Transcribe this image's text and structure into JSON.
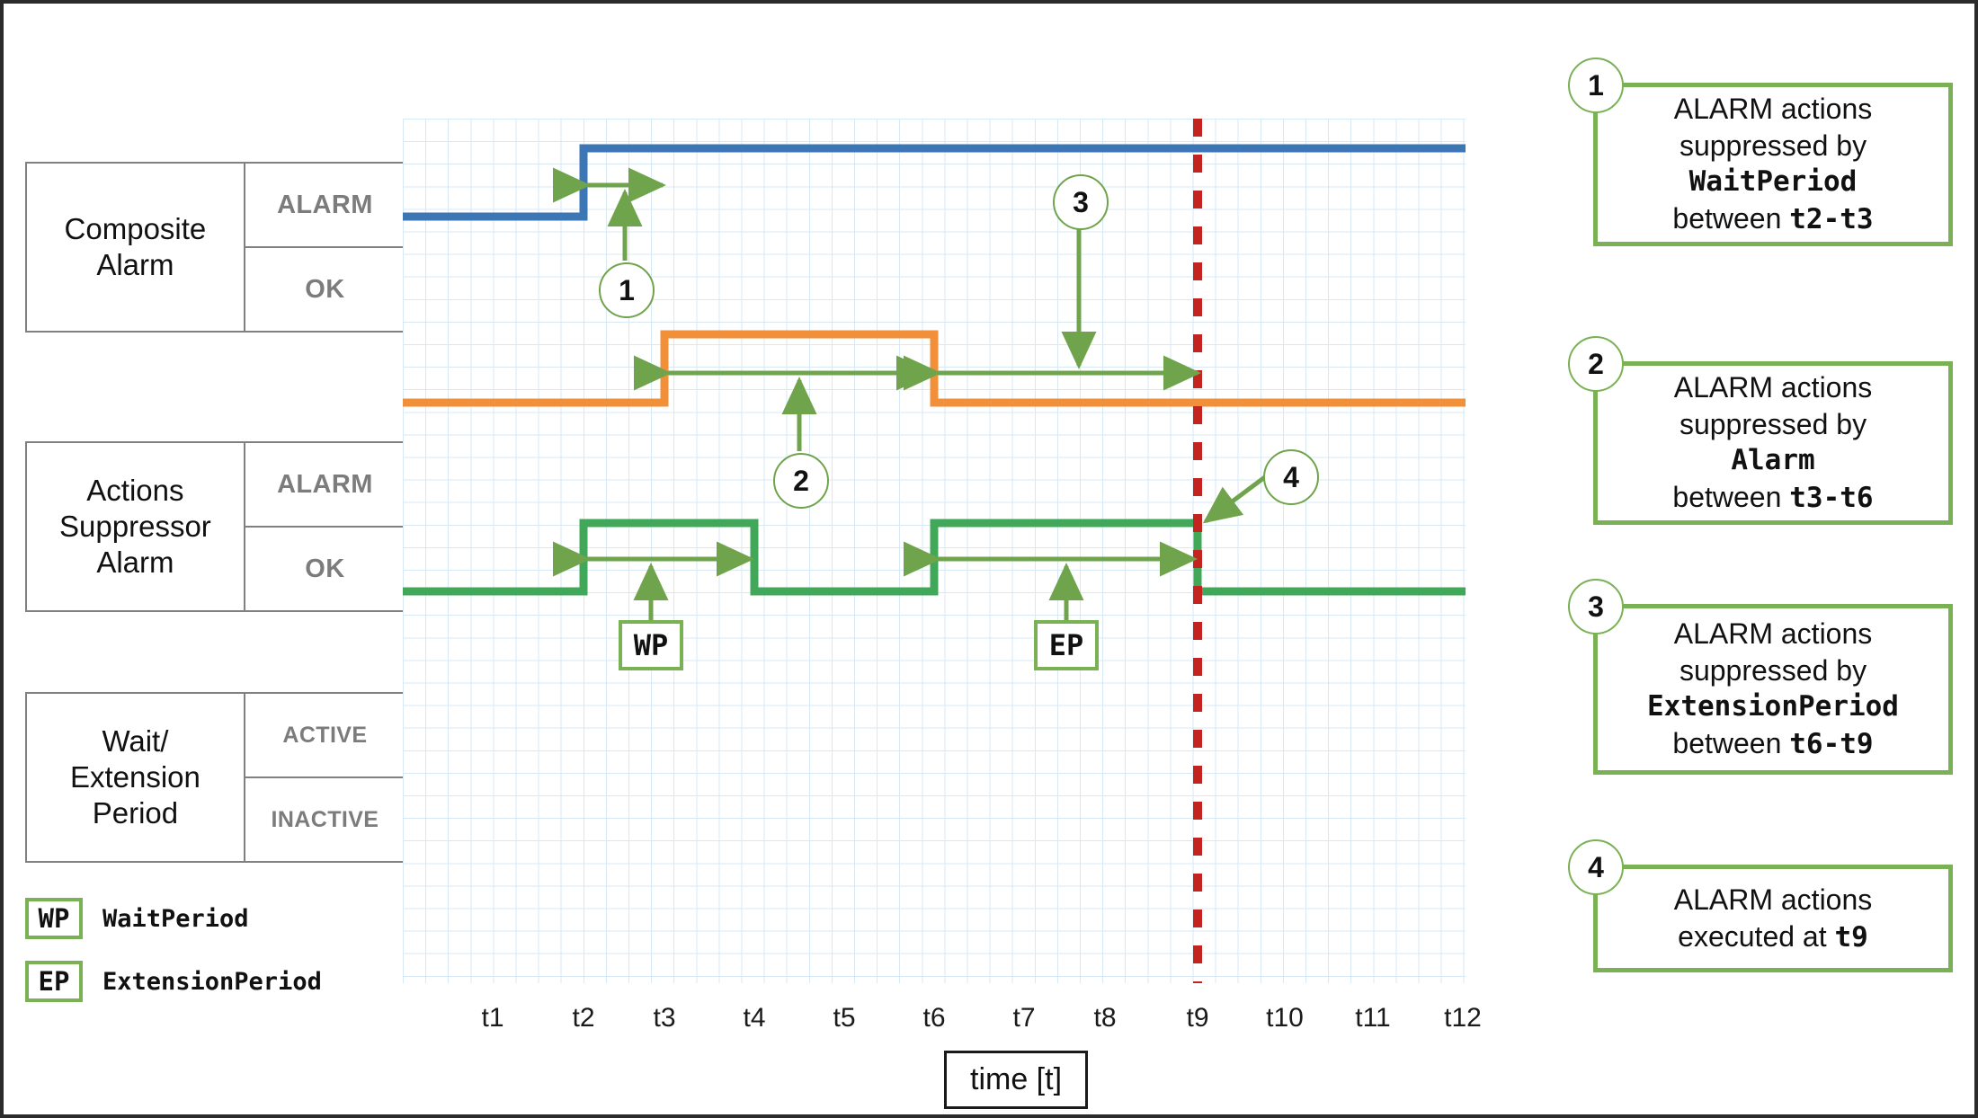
{
  "chart_data": {
    "type": "line",
    "title": "",
    "xlabel": "time [t]",
    "x_ticks": [
      "t1",
      "t2",
      "t3",
      "t4",
      "t5",
      "t6",
      "t7",
      "t8",
      "t9",
      "t10",
      "t11",
      "t12"
    ],
    "grid": true,
    "legend_position": "bottom-left",
    "series": [
      {
        "name": "Composite Alarm",
        "color": "#3c76b4",
        "states": [
          "OK",
          "ALARM"
        ],
        "steps": [
          {
            "from": "t0",
            "to": "t2",
            "value": "OK"
          },
          {
            "from": "t2",
            "to": "t12",
            "value": "ALARM"
          }
        ]
      },
      {
        "name": "Actions Suppressor Alarm",
        "color": "#f2903a",
        "states": [
          "OK",
          "ALARM"
        ],
        "steps": [
          {
            "from": "t0",
            "to": "t3",
            "value": "OK"
          },
          {
            "from": "t3",
            "to": "t6",
            "value": "ALARM"
          },
          {
            "from": "t6",
            "to": "t12",
            "value": "OK"
          }
        ]
      },
      {
        "name": "Wait/Extension Period",
        "color": "#41a85a",
        "states": [
          "INACTIVE",
          "ACTIVE"
        ],
        "steps": [
          {
            "from": "t0",
            "to": "t2",
            "value": "INACTIVE"
          },
          {
            "from": "t2",
            "to": "t4",
            "value": "ACTIVE"
          },
          {
            "from": "t4",
            "to": "t6",
            "value": "INACTIVE"
          },
          {
            "from": "t6",
            "to": "t9",
            "value": "ACTIVE"
          },
          {
            "from": "t9",
            "to": "t12",
            "value": "INACTIVE"
          }
        ]
      }
    ],
    "markers": [
      {
        "name": "event-line",
        "at": "t9",
        "color": "#c3241f",
        "style": "dashed"
      }
    ],
    "spans": [
      {
        "id": "1",
        "from": "t2",
        "to": "t3",
        "row": "Composite Alarm"
      },
      {
        "id": "2",
        "from": "t3",
        "to": "t6",
        "row": "Actions Suppressor Alarm"
      },
      {
        "id": "3",
        "from": "t6",
        "to": "t9",
        "row": "Actions Suppressor Alarm"
      },
      {
        "id": "WP",
        "from": "t2",
        "to": "t4",
        "row": "Wait/Extension Period"
      },
      {
        "id": "EP",
        "from": "t6",
        "to": "t9",
        "row": "Wait/Extension Period"
      }
    ]
  },
  "rows": [
    {
      "name_line1": "Composite",
      "name_line2": "Alarm",
      "name_line3": "",
      "high_label": "ALARM",
      "low_label": "OK"
    },
    {
      "name_line1": "Actions",
      "name_line2": "Suppressor",
      "name_line3": "Alarm",
      "high_label": "ALARM",
      "low_label": "OK"
    },
    {
      "name_line1": "Wait/",
      "name_line2": "Extension",
      "name_line3": "Period",
      "high_label": "ACTIVE",
      "low_label": "INACTIVE"
    }
  ],
  "legend": [
    {
      "chip": "WP",
      "label": "WaitPeriod"
    },
    {
      "chip": "EP",
      "label": "ExtensionPeriod"
    }
  ],
  "plot_markers": {
    "wp_tag": "WP",
    "ep_tag": "EP",
    "badge1": "1",
    "badge2": "2",
    "badge3": "3",
    "badge4": "4"
  },
  "axis": {
    "title": "time [t]",
    "ticks": [
      "t1",
      "t2",
      "t3",
      "t4",
      "t5",
      "t6",
      "t7",
      "t8",
      "t9",
      "t10",
      "t11",
      "t12"
    ]
  },
  "callouts": [
    {
      "number": "1",
      "line1": "ALARM actions",
      "line2": "suppressed by",
      "line3": "WaitPeriod",
      "line4_pre": "between ",
      "line4_mono": "t2-t3"
    },
    {
      "number": "2",
      "line1": "ALARM actions",
      "line2": "suppressed by",
      "line3": "Alarm",
      "line4_pre": "between ",
      "line4_mono": "t3-t6"
    },
    {
      "number": "3",
      "line1": "ALARM actions",
      "line2": "suppressed by",
      "line3": "ExtensionPeriod",
      "line4_pre": "between ",
      "line4_mono": "t6-t9"
    },
    {
      "number": "4",
      "line1": "ALARM actions",
      "line2": "",
      "line3": "",
      "line4_pre": "executed at ",
      "line4_mono": "t9"
    }
  ]
}
